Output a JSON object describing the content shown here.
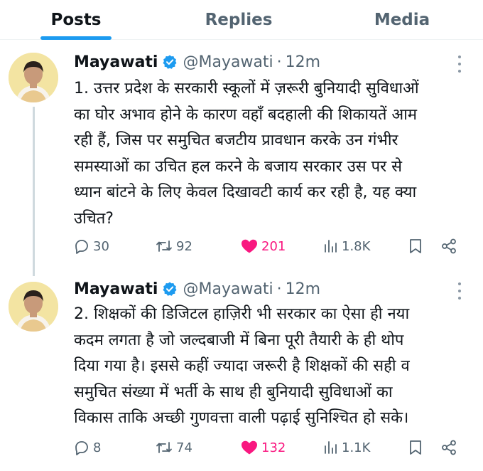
{
  "tabs": [
    {
      "label": "Posts",
      "active": true
    },
    {
      "label": "Replies",
      "active": false
    },
    {
      "label": "Media",
      "active": false
    }
  ],
  "colors": {
    "accent": "#1d9bf0",
    "like": "#f91880",
    "secondary_text": "#536471"
  },
  "tweets": [
    {
      "author": {
        "name": "Mayawati",
        "handle": "@Mayawati",
        "verified": true
      },
      "separator": "·",
      "time": "12m",
      "text_lines": [
        "1. उत्तर प्रदेश के सरकारी स्कूलों में ज़रूरी बुनियादी सुविधाओं",
        "का घोर अभाव होने के कारण वहाँ बदहाली की शिकायतें आम",
        "रही हैं, जिस पर समुचित बजटीय प्रावधान करके उन गंभीर",
        "समस्याओं का उचित हल करने के बजाय सरकार उस पर से",
        "ध्यान बांटने के लिए केवल दिखावटी कार्य कर रही है, यह क्या",
        "उचित?"
      ],
      "stats": {
        "replies": "30",
        "reposts": "92",
        "likes": "201",
        "views": "1.8K"
      },
      "liked": true
    },
    {
      "author": {
        "name": "Mayawati",
        "handle": "@Mayawati",
        "verified": true
      },
      "separator": "·",
      "time": "12m",
      "text_lines": [
        "2. शिक्षकों की डिजिटल हाज़िरी भी सरकार का ऐसा ही नया",
        "कदम लगता है जो जल्दबाजी में बिना पूरी तैयारी के ही थोप",
        "दिया गया है। इससे कहीं ज्यादा जरूरी है शिक्षकों की सही व",
        "समुचित संख्या में भर्ती के साथ ही बुनियादी सुविधाओं का",
        "विकास ताकि अच्छी गुणवत्ता वाली पढ़ाई सुनिश्चित हो सके।"
      ],
      "stats": {
        "replies": "8",
        "reposts": "74",
        "likes": "132",
        "views": "1.1K"
      },
      "liked": true
    }
  ],
  "icons": {
    "verified": "verified-badge-icon",
    "more": "more-options-icon",
    "reply": "reply-bubble-icon",
    "repost": "repost-arrows-icon",
    "like": "heart-icon",
    "views": "views-bars-icon",
    "bookmark": "bookmark-icon",
    "share": "share-icon"
  }
}
